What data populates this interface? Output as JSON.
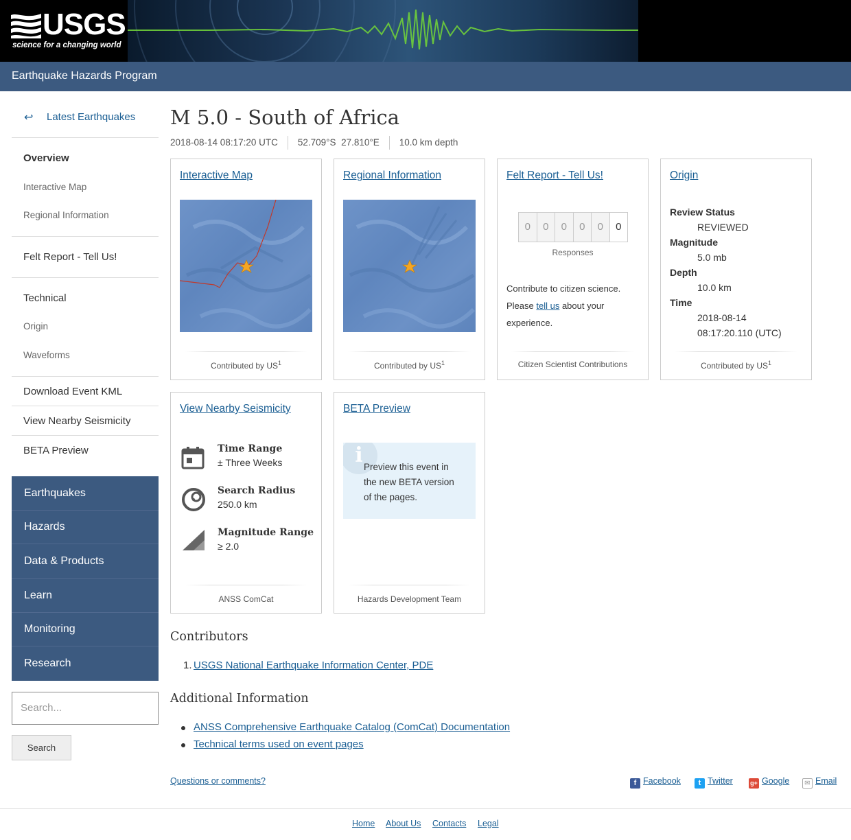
{
  "header": {
    "logo_text": "USGS",
    "logo_tagline": "science for a changing world",
    "program_title": "Earthquake Hazards Program"
  },
  "sidebar": {
    "back_label": "Latest Earthquakes",
    "items": [
      {
        "label": "Overview"
      },
      {
        "label": "Interactive Map"
      },
      {
        "label": "Regional Information"
      },
      {
        "label": "Felt Report - Tell Us!"
      },
      {
        "label": "Technical"
      },
      {
        "label": "Origin"
      },
      {
        "label": "Waveforms"
      },
      {
        "label": "Download Event KML"
      },
      {
        "label": "View Nearby Seismicity"
      },
      {
        "label": "BETA Preview"
      }
    ],
    "site_nav": [
      "Earthquakes",
      "Hazards",
      "Data & Products",
      "Learn",
      "Monitoring",
      "Research"
    ],
    "search_placeholder": "Search...",
    "search_button": "Search"
  },
  "event": {
    "title": "M 5.0 - South of Africa",
    "time": "2018-08-14 08:17:20 UTC",
    "lat": "52.709°S",
    "lon": "27.810°E",
    "depth": "10.0 km depth"
  },
  "cards": {
    "map": {
      "title": "Interactive Map",
      "foot": "Contributed by US",
      "sup": "1"
    },
    "regional": {
      "title": "Regional Information",
      "foot": "Contributed by US",
      "sup": "1"
    },
    "felt": {
      "title": "Felt Report - Tell Us!",
      "digits": [
        "0",
        "0",
        "0",
        "0",
        "0",
        "0"
      ],
      "responses_label": "Responses",
      "text1": "Contribute to citizen science.",
      "text2_pre": "Please ",
      "text2_link": "tell us",
      "text2_post": " about your",
      "text3": "experience.",
      "foot": "Citizen Scientist Contributions"
    },
    "origin": {
      "title": "Origin",
      "review_label": "Review Status",
      "review_value": "REVIEWED",
      "mag_label": "Magnitude",
      "mag_value": "5.0 mb",
      "depth_label": "Depth",
      "depth_value": "10.0 km",
      "time_label": "Time",
      "time_value1": "2018-08-14",
      "time_value2": "08:17:20.110 (UTC)",
      "foot": "Contributed by US",
      "sup": "1"
    },
    "seismicity": {
      "title": "View Nearby Seismicity",
      "time_label": "Time Range",
      "time_value": "± Three Weeks",
      "radius_label": "Search Radius",
      "radius_value": "250.0 km",
      "mag_label": "Magnitude Range",
      "mag_value": "≥ 2.0",
      "foot": "ANSS ComCat"
    },
    "beta": {
      "title": "BETA Preview",
      "text": "Preview this event in the new BETA version of the pages.",
      "foot": "Hazards Development Team"
    }
  },
  "contributors": {
    "heading": "Contributors",
    "items": [
      "USGS National Earthquake Information Center, PDE"
    ]
  },
  "additional": {
    "heading": "Additional Information",
    "items": [
      "ANSS Comprehensive Earthquake Catalog (ComCat) Documentation",
      "Technical terms used on event pages"
    ]
  },
  "footer": {
    "questions": "Questions or comments?",
    "share": [
      "Facebook",
      "Twitter",
      "Google",
      "Email"
    ],
    "links": [
      "Home",
      "About Us",
      "Contacts",
      "Legal"
    ]
  },
  "colors": {
    "nav_blue": "#3c5a80",
    "link_blue": "#1a5e93",
    "seismo_green": "#6fcf3a"
  }
}
